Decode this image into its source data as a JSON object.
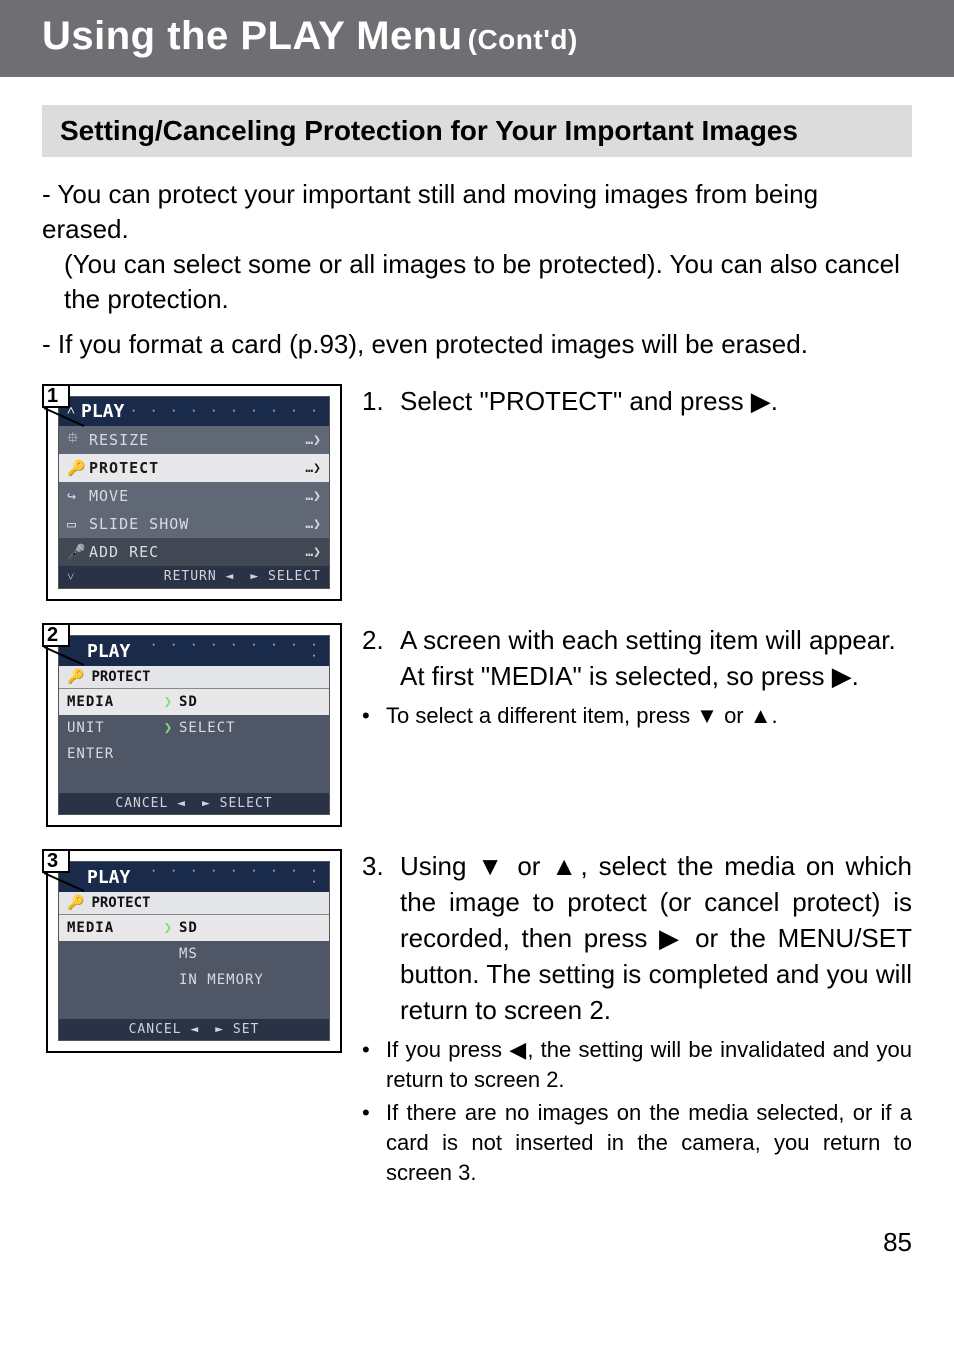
{
  "page_number": "85",
  "title_main": "Using the PLAY Menu",
  "title_sub": "(Cont'd)",
  "section_heading": "Setting/Canceling Protection for Your Important Images",
  "intro": {
    "p1a": "You can protect your important still and moving images from being erased.",
    "p1b": "(You can select some or all images to be protected). You can also cancel the protection.",
    "p2": "If you format a card (p.93), even protected images will be erased."
  },
  "screens": {
    "s1": {
      "num": "1",
      "header": "PLAY",
      "items": [
        {
          "icon": "⯐",
          "label": "RESIZE",
          "chev": "…❯",
          "kind": "dim"
        },
        {
          "icon": "🔑",
          "label": "PROTECT",
          "chev": "…❯",
          "kind": "sel"
        },
        {
          "icon": "↪",
          "label": "MOVE",
          "chev": "…❯",
          "kind": "dim"
        },
        {
          "icon": "▭",
          "label": "SLIDE SHOW",
          "chev": "…❯",
          "kind": "dim"
        },
        {
          "icon": "🎤",
          "label": "ADD REC",
          "chev": "…❯",
          "kind": "darker"
        }
      ],
      "footer_left": "RETURN ◄",
      "footer_right": "► SELECT"
    },
    "s2": {
      "num": "2",
      "header": "PLAY",
      "subheader_icon": "🔑",
      "subheader": "PROTECT",
      "rows": [
        {
          "label": "MEDIA",
          "chev": "❯",
          "value": "SD",
          "kind": "sel"
        },
        {
          "label": "UNIT",
          "chev": "❯",
          "value": "SELECT",
          "kind": "dim"
        },
        {
          "label": "ENTER",
          "chev": "",
          "value": "",
          "kind": "dim"
        }
      ],
      "footer_left": "CANCEL ◄",
      "footer_right": "► SELECT"
    },
    "s3": {
      "num": "3",
      "header": "PLAY",
      "subheader_icon": "🔑",
      "subheader": "PROTECT",
      "rows": [
        {
          "label": "MEDIA",
          "chev": "❯",
          "value": "SD",
          "kind": "sel"
        },
        {
          "label": "",
          "chev": "",
          "value": "MS",
          "kind": "dim"
        },
        {
          "label": "",
          "chev": "",
          "value": "IN MEMORY",
          "kind": "dim"
        }
      ],
      "footer_left": "CANCEL ◄",
      "footer_right": "► SET"
    }
  },
  "steps": {
    "s1": {
      "num": "1.",
      "text": "Select \"PROTECT\" and press ▶."
    },
    "s2": {
      "num": "2.",
      "text": "A screen with each setting item will appear. At first \"MEDIA\" is selected, so press ▶.",
      "b1": "To select a different item, press ▼ or ▲."
    },
    "s3": {
      "num": "3.",
      "text": "Using ▼ or ▲, select the media on which the image to protect (or cancel protect) is recorded, then press ▶ or the MENU/SET button. The setting is completed and you will return to screen 2.",
      "b1": "If you press ◀, the setting will be invalidated and you return to screen 2.",
      "b2": "If there are no images on the media selected, or if a card is not inserted in the camera, you return to screen 3."
    }
  }
}
